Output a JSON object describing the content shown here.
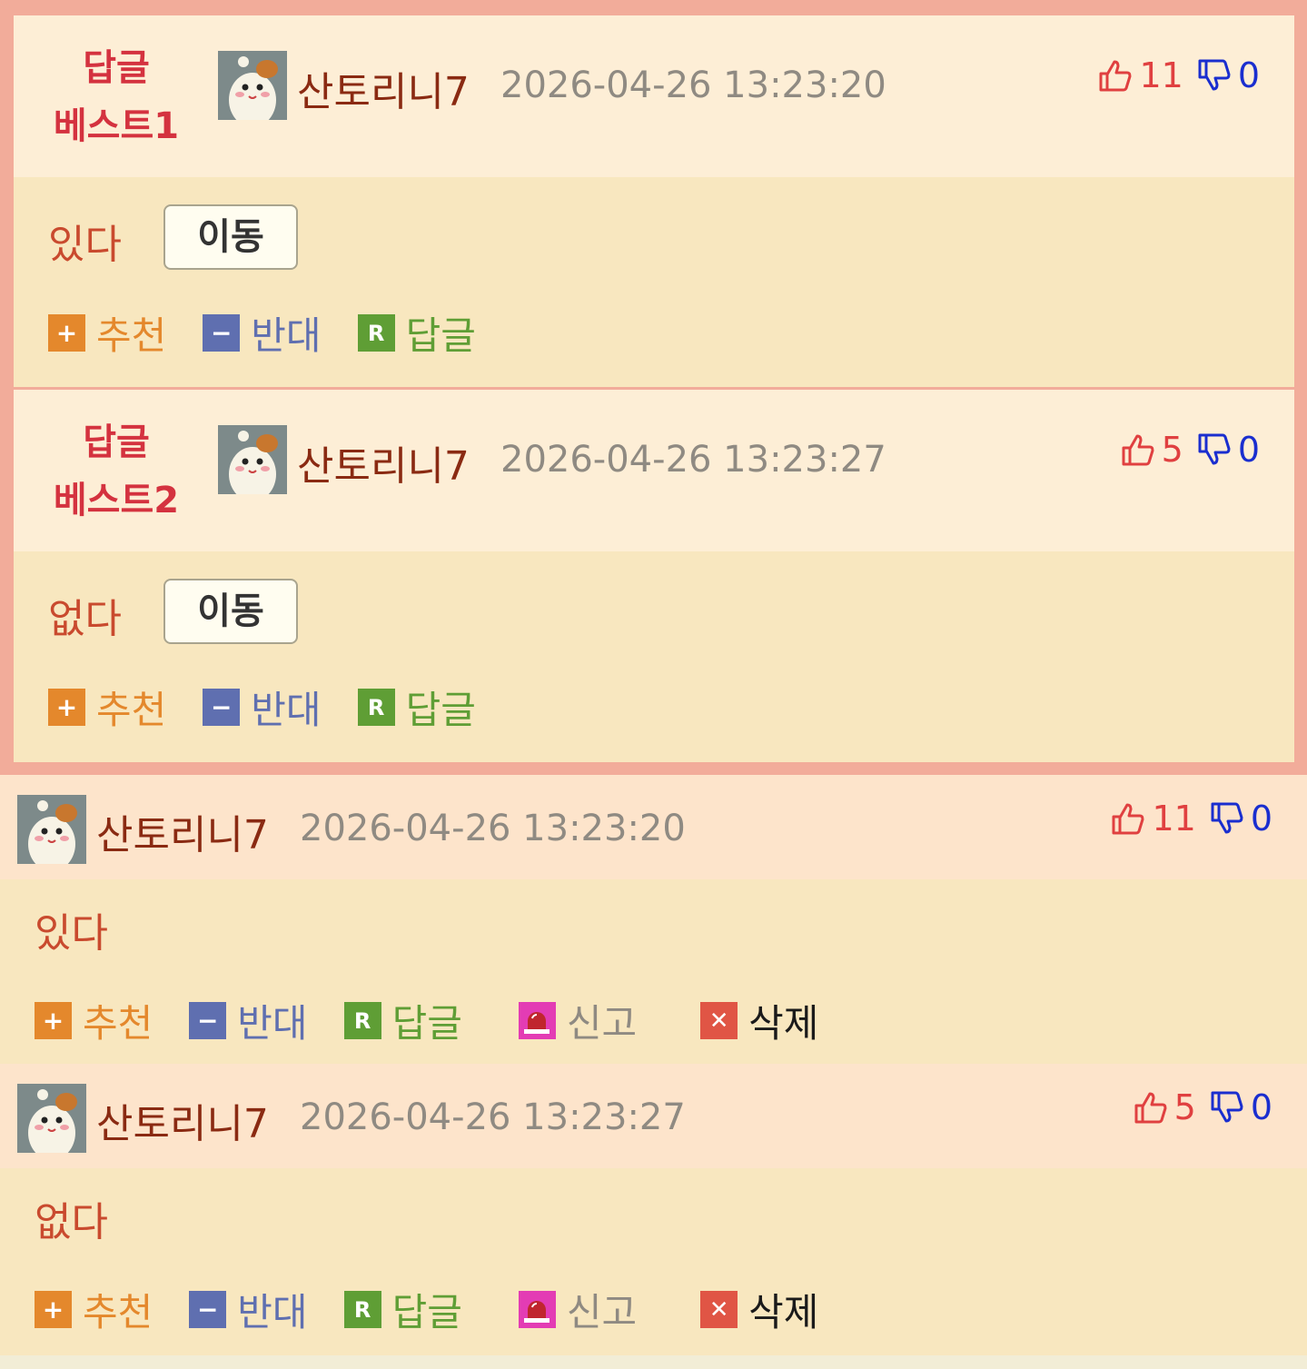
{
  "best_comments": [
    {
      "badge_line1": "답글",
      "badge_line2": "베스트1",
      "nickname": "산토리니7",
      "datetime": "2026-04-26 13:23:20",
      "likes": "11",
      "dislikes": "0",
      "content": "있다",
      "move_label": "이동",
      "actions": {
        "recommend": "추천",
        "oppose": "반대",
        "reply": "답글"
      }
    },
    {
      "badge_line1": "답글",
      "badge_line2": "베스트2",
      "nickname": "산토리니7",
      "datetime": "2026-04-26 13:23:27",
      "likes": "5",
      "dislikes": "0",
      "content": "없다",
      "move_label": "이동",
      "actions": {
        "recommend": "추천",
        "oppose": "반대",
        "reply": "답글"
      }
    }
  ],
  "comments": [
    {
      "nickname": "산토리니7",
      "datetime": "2026-04-26 13:23:20",
      "likes": "11",
      "dislikes": "0",
      "content": "있다",
      "actions": {
        "recommend": "추천",
        "oppose": "반대",
        "reply": "답글",
        "report": "신고",
        "delete": "삭제"
      }
    },
    {
      "nickname": "산토리니7",
      "datetime": "2026-04-26 13:23:27",
      "likes": "5",
      "dislikes": "0",
      "content": "없다",
      "actions": {
        "recommend": "추천",
        "oppose": "반대",
        "reply": "답글",
        "report": "신고",
        "delete": "삭제"
      }
    }
  ],
  "icons": {
    "recommend": "plus-square-icon",
    "oppose": "minus-square-icon",
    "reply": "r-square-icon",
    "report": "siren-icon",
    "delete": "x-square-icon",
    "like": "thumbs-up-icon",
    "dislike": "thumbs-down-icon"
  },
  "colors": {
    "best_border": "#f2ac9a",
    "header_bg": "#fdeed6",
    "body_bg": "#f8e7bf",
    "nickname": "#8a2a12",
    "likes": "#e04040",
    "dislikes": "#1a2ecf"
  }
}
